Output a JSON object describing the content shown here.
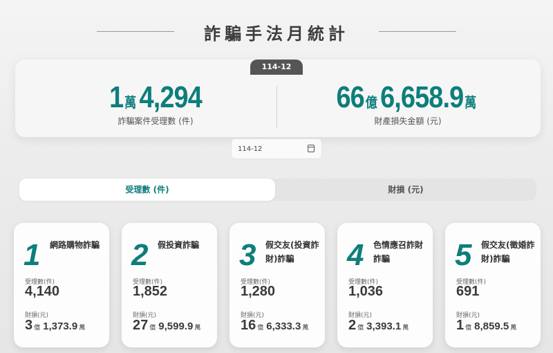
{
  "page": {
    "title": "詐騙手法月統計",
    "month_tab": "114-12"
  },
  "summary": {
    "cases": {
      "value_wan": "1",
      "unit_wan": "萬",
      "value_rest": "4,294",
      "label": "詐騙案件受理數 (件)"
    },
    "loss": {
      "value_yi": "66",
      "unit_yi": "億",
      "value_rest": "6,658.9",
      "unit_wan": "萬",
      "label": "財產損失金額 (元)"
    }
  },
  "date_picker": {
    "value": "114-12",
    "icon": "calendar-icon"
  },
  "tabs": [
    {
      "label": "受理數 (件)",
      "active": true
    },
    {
      "label": "財損 (元)",
      "active": false
    }
  ],
  "labels": {
    "cases": "受理數(件)",
    "loss": "財損(元)",
    "yi": "億",
    "wan": "萬"
  },
  "cards": [
    {
      "rank": "1",
      "name": "網路購物詐騙",
      "cases": "4,140",
      "loss_yi": "3",
      "loss_wan": "1,373.9"
    },
    {
      "rank": "2",
      "name": "假投資詐騙",
      "cases": "1,852",
      "loss_yi": "27",
      "loss_wan": "9,599.9"
    },
    {
      "rank": "3",
      "name": "假交友(投資詐財)詐騙",
      "cases": "1,280",
      "loss_yi": "16",
      "loss_wan": "6,333.3"
    },
    {
      "rank": "4",
      "name": "色情應召詐財詐騙",
      "cases": "1,036",
      "loss_yi": "2",
      "loss_wan": "3,393.1"
    },
    {
      "rank": "5",
      "name": "假交友(徵婚詐財)詐騙",
      "cases": "691",
      "loss_yi": "1",
      "loss_wan": "8,859.5"
    }
  ],
  "colors": {
    "accent": "#0d7e7b",
    "text": "#3a3a3a",
    "tab_bg": "#555555"
  }
}
